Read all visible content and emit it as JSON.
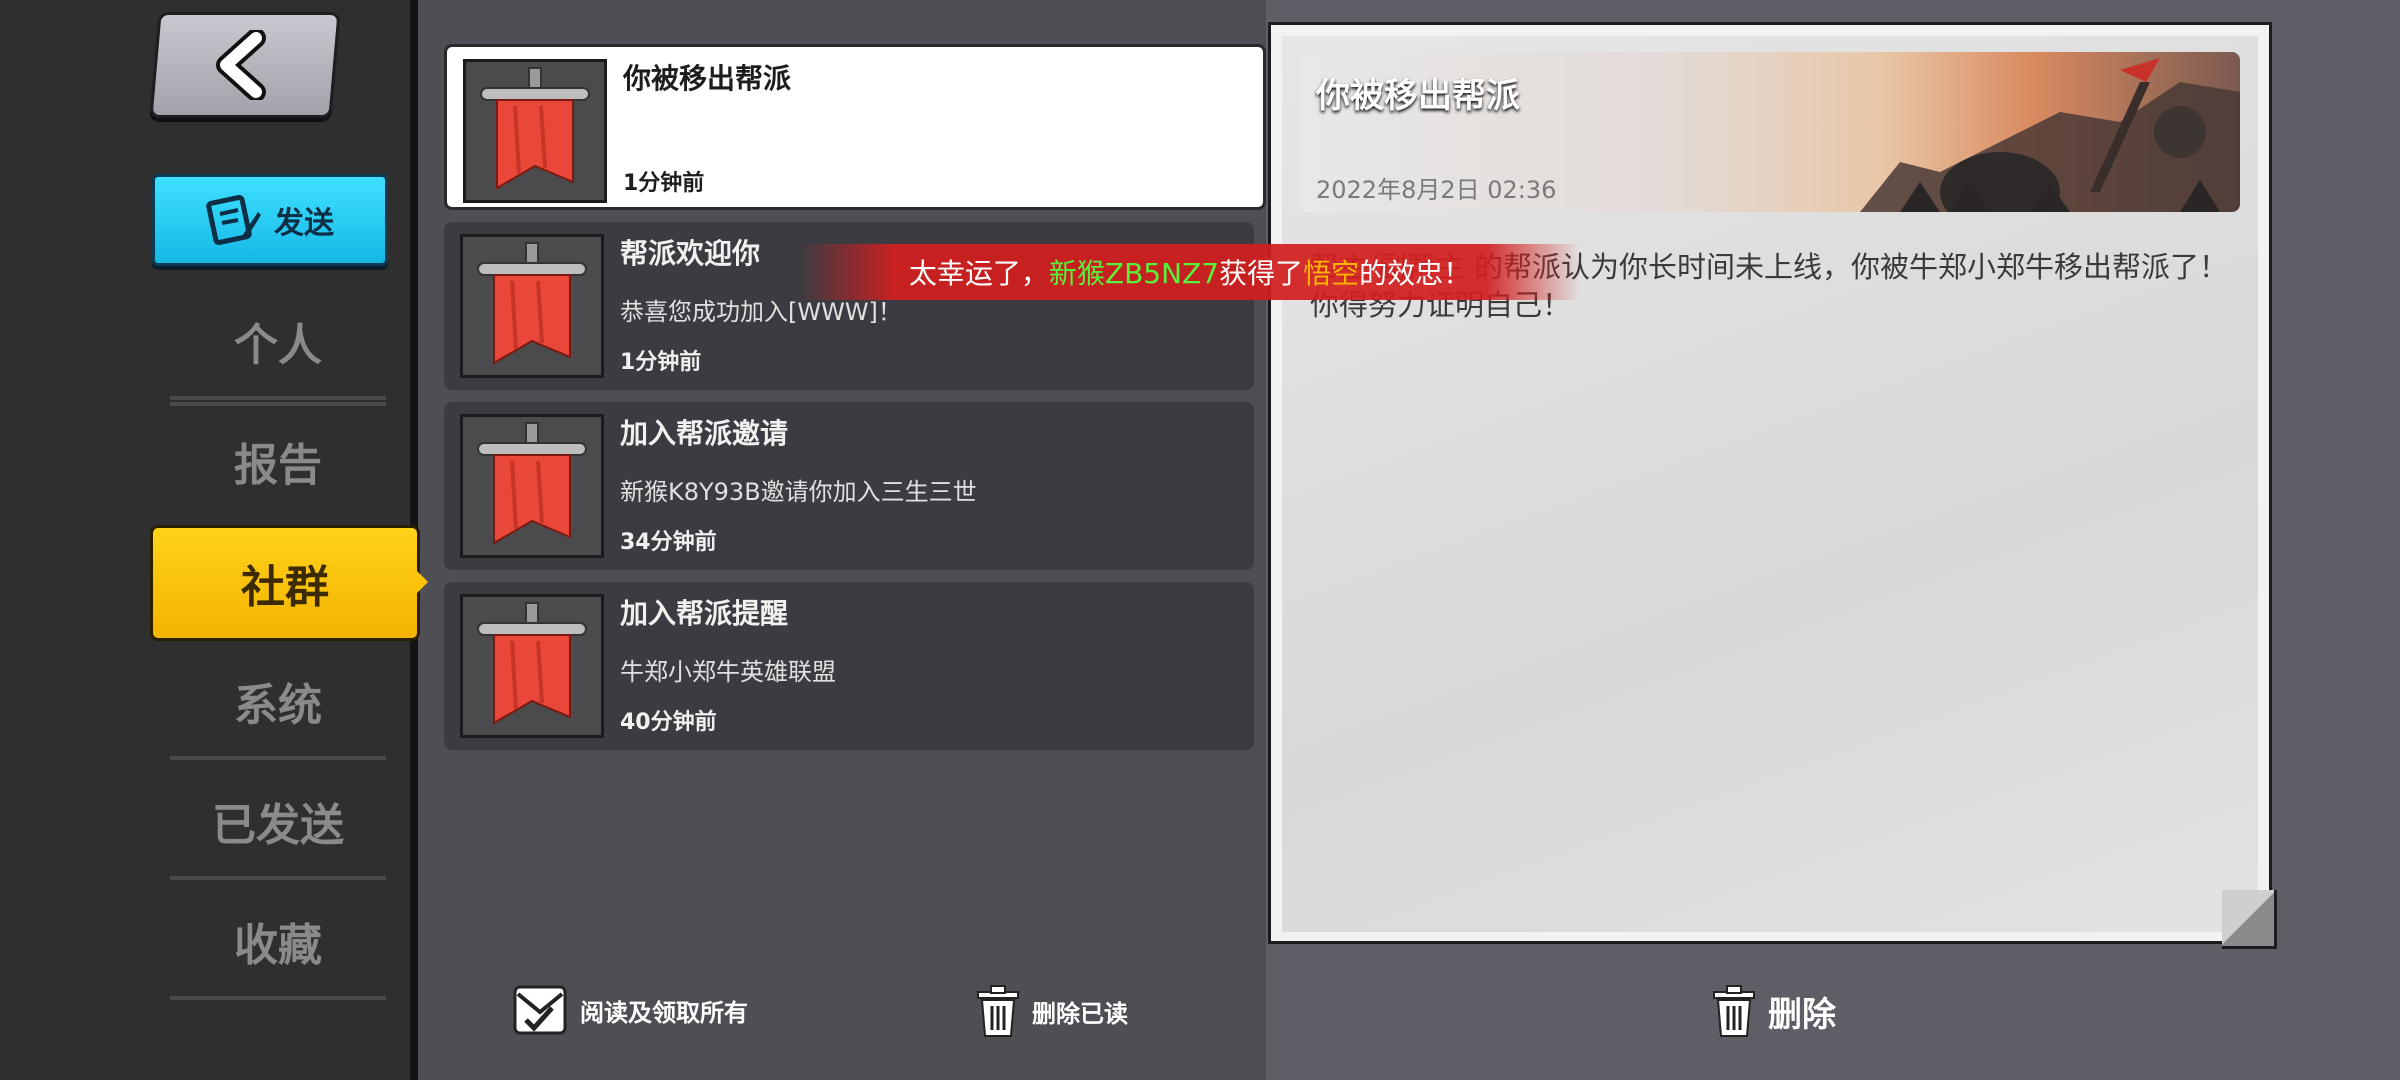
{
  "sidebar": {
    "send_label": "发送",
    "nav": [
      {
        "label": "个人"
      },
      {
        "label": "报告"
      },
      {
        "label": "社群"
      },
      {
        "label": "系统"
      },
      {
        "label": "已发送"
      },
      {
        "label": "收藏"
      }
    ]
  },
  "mail_list": [
    {
      "title": "你被移出帮派",
      "desc": "",
      "time": "1分钟前",
      "icon": "red-banner-icon"
    },
    {
      "title": "帮派欢迎你",
      "desc": "恭喜您成功加入[WWW]！",
      "time": "1分钟前",
      "icon": "red-banner-icon"
    },
    {
      "title": "加入帮派邀请",
      "desc": "新猴K8Y93B邀请你加入三生三世",
      "time": "34分钟前",
      "icon": "red-banner-icon"
    },
    {
      "title": "加入帮派提醒",
      "desc": "牛郑小郑牛英雄联盟",
      "time": "40分钟前",
      "icon": "red-banner-icon"
    }
  ],
  "toast": {
    "prefix": "太幸运了，",
    "player": "新猴ZB5NZ7",
    "middle": "获得了",
    "hero": "悟空",
    "suffix": "的效忠！"
  },
  "detail": {
    "title": "你被移出帮派",
    "date": "2022年8月2日 02:36",
    "body": "帮主/副帮主 的帮派认为你长时间未上线，你被牛郑小郑牛移出帮派了！你得努力证明自己！"
  },
  "footer": {
    "read_all_label": "阅读及领取所有",
    "delete_read_label": "删除已读",
    "delete_label": "删除"
  },
  "colors": {
    "accent_yellow": "#ffc40a",
    "send_cyan": "#15b8e6",
    "toast_red": "#d21e1e",
    "toast_green": "#58f23c",
    "toast_orange": "#ffb400"
  }
}
